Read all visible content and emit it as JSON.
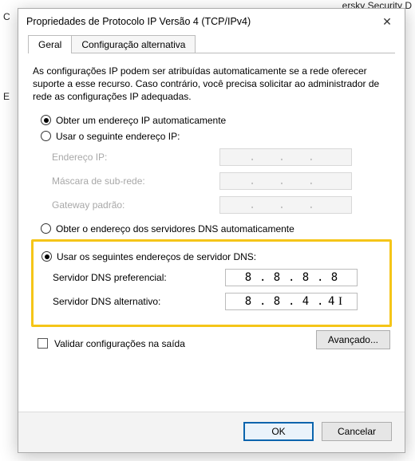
{
  "backdrop": {
    "top_left": "C",
    "left_e": "E",
    "right_title": "ersky Security D"
  },
  "dialog": {
    "title": "Propriedades de Protocolo IP Versão 4 (TCP/IPv4)",
    "close_glyph": "✕",
    "tabs": {
      "general": "Geral",
      "alt": "Configuração alternativa"
    },
    "description": "As configurações IP podem ser atribuídas automaticamente se a rede oferecer suporte a esse recurso. Caso contrário, você precisa solicitar ao administrador de rede as configurações IP adequadas.",
    "ip_auto_label": "Obter um endereço IP automaticamente",
    "ip_manual_label": "Usar o seguinte endereço IP:",
    "ip_fields": {
      "ip": "Endereço IP:",
      "mask": "Máscara de sub-rede:",
      "gw": "Gateway padrão:",
      "dots": ".     .     ."
    },
    "dns_auto_label": "Obter o endereço dos servidores DNS automaticamente",
    "dns_manual_label": "Usar os seguintes endereços de servidor DNS:",
    "dns_fields": {
      "pref_label": "Servidor DNS preferencial:",
      "alt_label": "Servidor DNS alternativo:",
      "pref": [
        "8",
        "8",
        "8",
        "8"
      ],
      "alt": [
        "8",
        "8",
        "4",
        "4"
      ]
    },
    "validate_label": "Validar configurações na saída",
    "advanced_label": "Avançado...",
    "ok_label": "OK",
    "cancel_label": "Cancelar"
  }
}
